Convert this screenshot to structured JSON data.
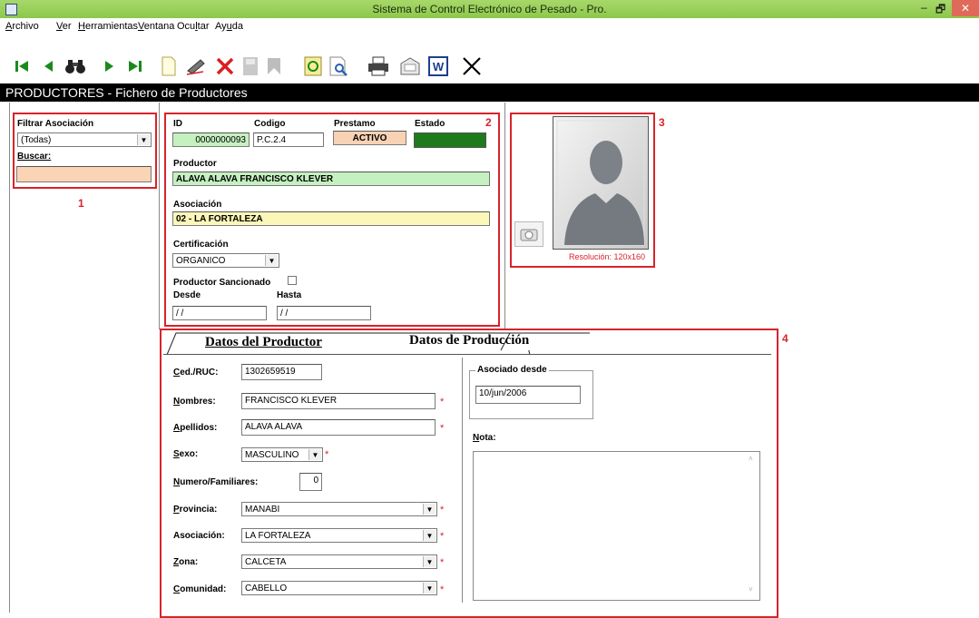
{
  "window": {
    "title": "Sistema de Control Electrónico de Pesado - Pro.",
    "minimize": "–",
    "restore": "🗗",
    "close": "✕"
  },
  "menu": [
    {
      "label": "Archivo",
      "mnemonic": "A",
      "rest": "rchivo"
    },
    {
      "label": "Ver",
      "mnemonic": "V",
      "rest": "er"
    },
    {
      "label": "Herramientas",
      "mnemonic": "H",
      "rest": "erramientas"
    },
    {
      "label": "Ventana",
      "mnemonic": "V",
      "rest": "entana"
    },
    {
      "label": "Ocultar",
      "pre": "Ocu",
      "mnemonic": "l",
      "rest": "tar"
    },
    {
      "label": "Ayuda",
      "pre": "Ay",
      "mnemonic": "u",
      "rest": "da"
    }
  ],
  "toolbar": {
    "icons": [
      "first-record-icon",
      "previous-record-icon",
      "search-binoculars-icon",
      "next-record-icon",
      "last-record-icon",
      "new-document-icon",
      "edit-icon",
      "delete-icon",
      "save-icon",
      "undo-icon",
      "refresh-icon",
      "preview-icon",
      "print-icon",
      "export-icon",
      "word-icon",
      "exit-icon"
    ]
  },
  "module": {
    "title": "PRODUCTORES - Fichero de Productores"
  },
  "colors": {
    "accent_green": "#9ccf5f",
    "highlight_red": "#d8232a",
    "id_bg": "#c5f0c0",
    "prestamo_bg": "#f7d2b4",
    "estado_green": "#1d7b1d",
    "productor_bg": "#c5f0c0",
    "asociacion_bg": "#fbf7b8",
    "buscar_bg": "#fbd4b5"
  },
  "panel1": {
    "number": "1",
    "filter_label": "Filtrar Asociación",
    "filter_value": "(Todas)",
    "search_label": "Buscar:",
    "search_value": ""
  },
  "panel2": {
    "number": "2",
    "id_label": "ID",
    "id_value": "0000000093",
    "codigo_label": "Codigo",
    "codigo_value": "P.C.2.4",
    "prestamo_label": "Prestamo",
    "prestamo_value": "ACTIVO",
    "estado_label": "Estado",
    "productor_label": "Productor",
    "productor_value": "ALAVA ALAVA FRANCISCO KLEVER",
    "asociacion_label": "Asociación",
    "asociacion_value": "02 - LA FORTALEZA",
    "certificacion_label": "Certificación",
    "certificacion_value": "ORGANICO",
    "sancionado_label": "Productor Sancionado",
    "sancionado_checked": false,
    "desde_label": "Desde",
    "desde_value": " / /",
    "hasta_label": "Hasta",
    "hasta_value": " / /"
  },
  "panel3": {
    "number": "3",
    "resolution": "Resolución: 120x160"
  },
  "panel4": {
    "number": "4",
    "tabs": [
      {
        "label": "Datos del Productor",
        "active": true
      },
      {
        "label": "Datos de Producción",
        "active": false
      }
    ],
    "fields": {
      "ced_label_u": "C",
      "ced_label_rest": "ed./RUC:",
      "ced_value": "1302659519",
      "nombres_label_u": "N",
      "nombres_label_rest": "ombres:",
      "nombres_value": "FRANCISCO KLEVER",
      "apellidos_label_u": "A",
      "apellidos_label_rest": "pellidos:",
      "apellidos_value": "ALAVA ALAVA",
      "sexo_label_u": "S",
      "sexo_label_rest": "exo:",
      "sexo_value": "MASCULINO",
      "familiares_label_u": "N",
      "familiares_label_rest": "umero/Familiares:",
      "familiares_value": "0",
      "provincia_label_u": "P",
      "provincia_label_rest": "rovincia:",
      "provincia_value": "MANABI",
      "asociacion_label": "Asociación:",
      "asociacion_value": "LA FORTALEZA",
      "zona_label_u": "Z",
      "zona_label_rest": "ona:",
      "zona_value": "CALCETA",
      "comunidad_label_u": "C",
      "comunidad_label_rest": "omunidad:",
      "comunidad_value": "CABELLO",
      "required": "*"
    },
    "asociado_desde_label": "Asociado desde",
    "asociado_desde_value": "10/jun/2006",
    "nota_label_u": "N",
    "nota_label_rest": "ota:",
    "nota_value": ""
  }
}
